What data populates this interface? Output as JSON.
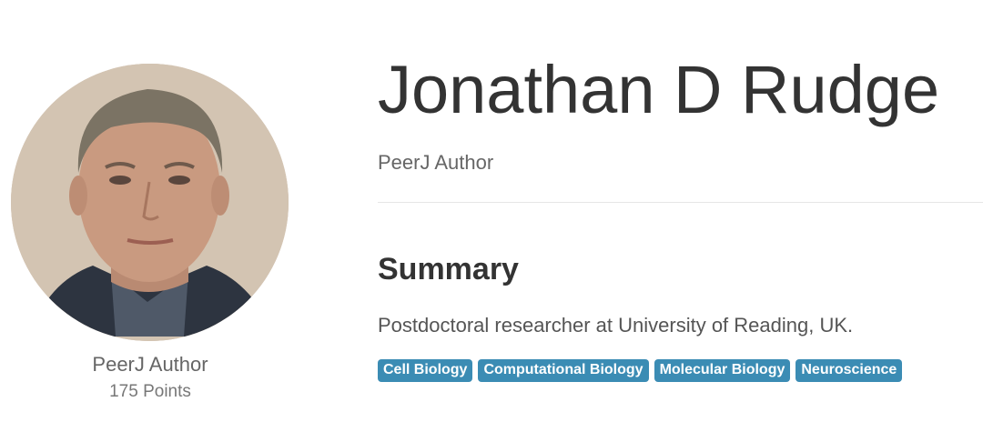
{
  "profile": {
    "name": "Jonathan D Rudge",
    "subtitle": "PeerJ Author",
    "avatar_icon": "profile-photo",
    "role_label": "PeerJ Author",
    "points_label": "175 Points"
  },
  "summary": {
    "heading": "Summary",
    "text": "Postdoctoral researcher at University of Reading, UK."
  },
  "tags": [
    "Cell Biology",
    "Computational Biology",
    "Molecular Biology",
    "Neuroscience"
  ],
  "colors": {
    "tag_background": "#3b8cb4",
    "tag_text": "#ffffff",
    "heading_text": "#333333",
    "muted_text": "#666666"
  }
}
